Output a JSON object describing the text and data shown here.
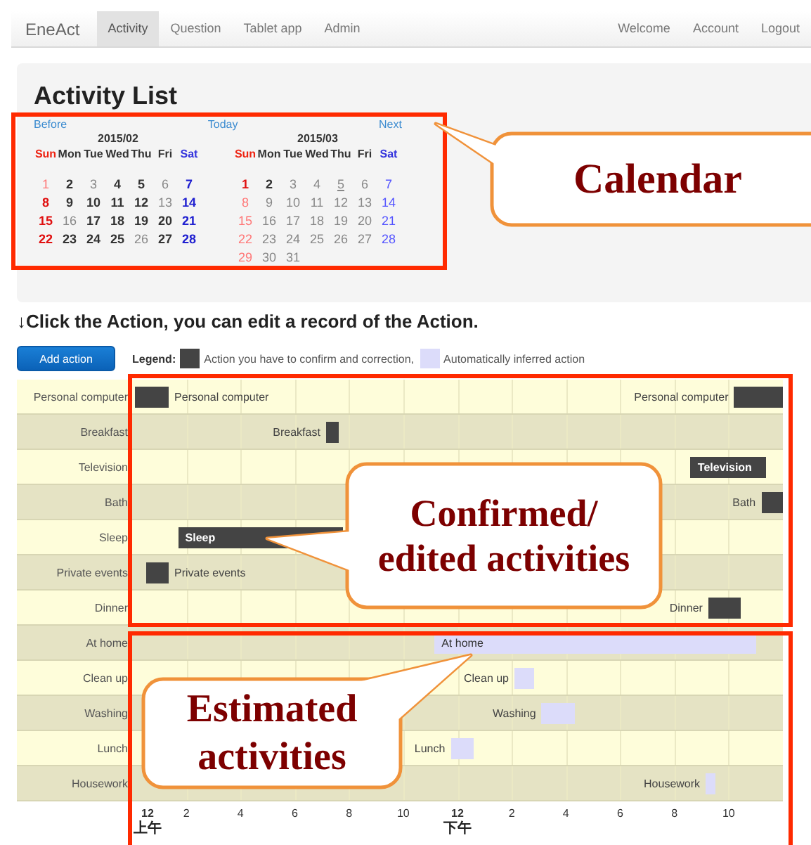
{
  "navbar": {
    "brand": "EneAct",
    "tabs": [
      {
        "label": "Activity",
        "selected": true
      },
      {
        "label": "Question",
        "selected": false
      },
      {
        "label": "Tablet app",
        "selected": false
      },
      {
        "label": "Admin",
        "selected": false
      }
    ],
    "links": [
      "Welcome",
      "Account",
      "Logout"
    ]
  },
  "page_title": "Activity List",
  "calendar": {
    "previous": "Before",
    "today": "Today",
    "next": "Next",
    "months": [
      {
        "title": "2015/02",
        "weekdays": [
          "Sun",
          "Mon",
          "Tue",
          "Wed",
          "Thu",
          "Fri",
          "Sat"
        ],
        "days": [
          {
            "day": "1",
            "recorded": false,
            "today": false
          },
          {
            "day": "2",
            "recorded": true,
            "today": false
          },
          {
            "day": "3",
            "recorded": false,
            "today": false
          },
          {
            "day": "4",
            "recorded": true,
            "today": false
          },
          {
            "day": "5",
            "recorded": true,
            "today": false
          },
          {
            "day": "6",
            "recorded": false,
            "today": false
          },
          {
            "day": "7",
            "recorded": true,
            "today": false
          },
          {
            "day": "8",
            "recorded": true,
            "today": false
          },
          {
            "day": "9",
            "recorded": true,
            "today": false
          },
          {
            "day": "10",
            "recorded": true,
            "today": false
          },
          {
            "day": "11",
            "recorded": true,
            "today": false
          },
          {
            "day": "12",
            "recorded": true,
            "today": false
          },
          {
            "day": "13",
            "recorded": false,
            "today": false
          },
          {
            "day": "14",
            "recorded": true,
            "today": false
          },
          {
            "day": "15",
            "recorded": true,
            "today": false
          },
          {
            "day": "16",
            "recorded": false,
            "today": false
          },
          {
            "day": "17",
            "recorded": true,
            "today": false
          },
          {
            "day": "18",
            "recorded": true,
            "today": false
          },
          {
            "day": "19",
            "recorded": true,
            "today": false
          },
          {
            "day": "20",
            "recorded": true,
            "today": false
          },
          {
            "day": "21",
            "recorded": true,
            "today": false
          },
          {
            "day": "22",
            "recorded": true,
            "today": false
          },
          {
            "day": "23",
            "recorded": true,
            "today": false
          },
          {
            "day": "24",
            "recorded": true,
            "today": false
          },
          {
            "day": "25",
            "recorded": true,
            "today": false
          },
          {
            "day": "26",
            "recorded": false,
            "today": false
          },
          {
            "day": "27",
            "recorded": true,
            "today": false
          },
          {
            "day": "28",
            "recorded": true,
            "today": false
          }
        ]
      },
      {
        "title": "2015/03",
        "weekdays": [
          "Sun",
          "Mon",
          "Tue",
          "Wed",
          "Thu",
          "Fri",
          "Sat"
        ],
        "days": [
          {
            "day": "1",
            "recorded": true,
            "today": false
          },
          {
            "day": "2",
            "recorded": true,
            "today": false
          },
          {
            "day": "3",
            "recorded": false,
            "today": false
          },
          {
            "day": "4",
            "recorded": false,
            "today": false
          },
          {
            "day": "5",
            "recorded": false,
            "today": true
          },
          {
            "day": "6",
            "recorded": false,
            "today": false
          },
          {
            "day": "7",
            "recorded": false,
            "today": false
          },
          {
            "day": "8",
            "recorded": false,
            "today": false
          },
          {
            "day": "9",
            "recorded": false,
            "today": false
          },
          {
            "day": "10",
            "recorded": false,
            "today": false
          },
          {
            "day": "11",
            "recorded": false,
            "today": false
          },
          {
            "day": "12",
            "recorded": false,
            "today": false
          },
          {
            "day": "13",
            "recorded": false,
            "today": false
          },
          {
            "day": "14",
            "recorded": false,
            "today": false
          },
          {
            "day": "15",
            "recorded": false,
            "today": false
          },
          {
            "day": "16",
            "recorded": false,
            "today": false
          },
          {
            "day": "17",
            "recorded": false,
            "today": false
          },
          {
            "day": "18",
            "recorded": false,
            "today": false
          },
          {
            "day": "19",
            "recorded": false,
            "today": false
          },
          {
            "day": "20",
            "recorded": false,
            "today": false
          },
          {
            "day": "21",
            "recorded": false,
            "today": false
          },
          {
            "day": "22",
            "recorded": false,
            "today": false
          },
          {
            "day": "23",
            "recorded": false,
            "today": false
          },
          {
            "day": "24",
            "recorded": false,
            "today": false
          },
          {
            "day": "25",
            "recorded": false,
            "today": false
          },
          {
            "day": "26",
            "recorded": false,
            "today": false
          },
          {
            "day": "27",
            "recorded": false,
            "today": false
          },
          {
            "day": "28",
            "recorded": false,
            "today": false
          },
          {
            "day": "29",
            "recorded": false,
            "today": false
          },
          {
            "day": "30",
            "recorded": false,
            "today": false
          },
          {
            "day": "31",
            "recorded": false,
            "today": false
          }
        ]
      }
    ]
  },
  "instruction": "↓Click the Action, you can edit a record of the Action.",
  "add_button": "Add action",
  "legend": {
    "title": "Legend:",
    "items": [
      {
        "kind": "confirmed",
        "label": "Action you have to confirm and correction,"
      },
      {
        "kind": "estimated",
        "label": "Automatically inferred action"
      }
    ]
  },
  "timeline": {
    "rows": [
      {
        "label": "Personal computer",
        "kind": "confirmed",
        "bars": [
          {
            "text": "Personal computer",
            "kind": "right"
          },
          {
            "text": "Personal computer",
            "kind": "left"
          }
        ]
      },
      {
        "label": "Breakfast",
        "kind": "confirmed",
        "bars": [
          {
            "text": "Breakfast",
            "kind": "left"
          }
        ]
      },
      {
        "label": "Television",
        "kind": "confirmed",
        "bars": [
          {
            "text": "Television",
            "kind": "inside"
          }
        ]
      },
      {
        "label": "Bath",
        "kind": "confirmed",
        "bars": [
          {
            "text": "Bath",
            "kind": "left"
          }
        ]
      },
      {
        "label": "Sleep",
        "kind": "confirmed",
        "bars": [
          {
            "text": "Sleep",
            "kind": "inside"
          }
        ]
      },
      {
        "label": "Private events",
        "kind": "confirmed",
        "bars": [
          {
            "text": "Private events",
            "kind": "right"
          }
        ]
      },
      {
        "label": "Dinner",
        "kind": "confirmed",
        "bars": [
          {
            "text": "Dinner",
            "kind": "left"
          }
        ]
      },
      {
        "label": "At home",
        "kind": "estimated",
        "bars": [
          {
            "text": "At home",
            "kind": "inside"
          }
        ]
      },
      {
        "label": "Clean up",
        "kind": "estimated",
        "bars": [
          {
            "text": "Clean up",
            "kind": "left"
          }
        ]
      },
      {
        "label": "Washing",
        "kind": "estimated",
        "bars": [
          {
            "text": "Washing",
            "kind": "left"
          }
        ]
      },
      {
        "label": "Lunch",
        "kind": "estimated",
        "bars": [
          {
            "text": "Lunch",
            "kind": "left"
          }
        ]
      },
      {
        "label": "Housework",
        "kind": "estimated",
        "bars": [
          {
            "text": "Housework",
            "kind": "left"
          }
        ]
      }
    ],
    "axis": [
      {
        "label": "12",
        "period": "上午"
      },
      {
        "label": "2"
      },
      {
        "label": "4"
      },
      {
        "label": "6"
      },
      {
        "label": "8"
      },
      {
        "label": "10"
      },
      {
        "label": "12",
        "period": "下午"
      },
      {
        "label": "2"
      },
      {
        "label": "4"
      },
      {
        "label": "6"
      },
      {
        "label": "8"
      },
      {
        "label": "10"
      }
    ]
  },
  "annotations": [
    {
      "lines": [
        "Calendar"
      ]
    },
    {
      "lines": [
        "Confirmed/",
        "edited activities"
      ]
    },
    {
      "lines": [
        "Estimated",
        "activities"
      ]
    }
  ]
}
